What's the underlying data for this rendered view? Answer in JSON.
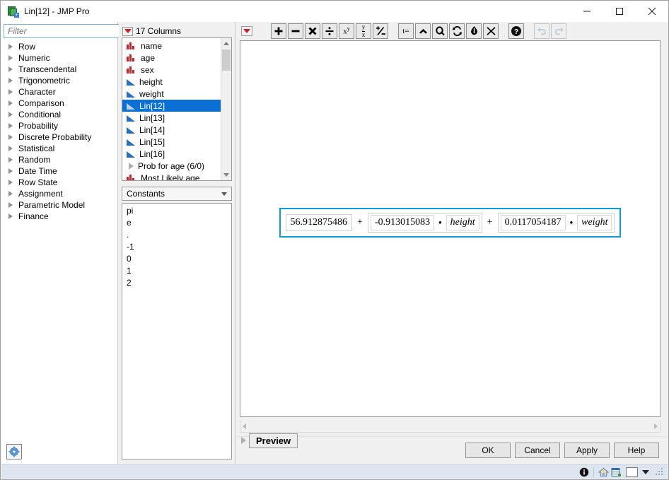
{
  "window": {
    "title": "Lin[12] - JMP Pro",
    "app_icon": "jmp-formula-icon",
    "minimize": "minimize-icon",
    "maximize": "maximize-icon",
    "close": "close-icon"
  },
  "left_panel": {
    "filter": {
      "placeholder": "Filter",
      "value": "",
      "search_icon": "search-icon",
      "dropdown_icon": "chevron-down-icon"
    },
    "functions": [
      {
        "label": "Row"
      },
      {
        "label": "Numeric"
      },
      {
        "label": "Transcendental"
      },
      {
        "label": "Trigonometric"
      },
      {
        "label": "Character"
      },
      {
        "label": "Comparison"
      },
      {
        "label": "Conditional"
      },
      {
        "label": "Probability"
      },
      {
        "label": "Discrete Probability"
      },
      {
        "label": "Statistical"
      },
      {
        "label": "Random"
      },
      {
        "label": "Date Time"
      },
      {
        "label": "Row State"
      },
      {
        "label": "Assignment"
      },
      {
        "label": "Parametric Model"
      },
      {
        "label": "Finance"
      }
    ],
    "settings_button": "settings-gear"
  },
  "columns_panel": {
    "header": "17 Columns",
    "header_menu_icon": "red-triangle-menu",
    "items": [
      {
        "label": "name",
        "type": "nominal",
        "selected": false
      },
      {
        "label": "age",
        "type": "nominal",
        "selected": false
      },
      {
        "label": "sex",
        "type": "nominal",
        "selected": false
      },
      {
        "label": "height",
        "type": "continuous",
        "selected": false
      },
      {
        "label": "weight",
        "type": "continuous",
        "selected": false
      },
      {
        "label": "Lin[12]",
        "type": "continuous-dim",
        "selected": true
      },
      {
        "label": "Lin[13]",
        "type": "continuous",
        "selected": false
      },
      {
        "label": "Lin[14]",
        "type": "continuous",
        "selected": false
      },
      {
        "label": "Lin[15]",
        "type": "continuous",
        "selected": false
      },
      {
        "label": "Lin[16]",
        "type": "continuous",
        "selected": false
      },
      {
        "label": "Prob for age (6/0)",
        "type": "group",
        "selected": false
      },
      {
        "label": "Most Likely age",
        "type": "nominal",
        "selected": false
      }
    ],
    "category_select": {
      "value": "Constants",
      "caret_icon": "chevron-down-icon"
    },
    "constants": [
      "pi",
      "e",
      ".",
      "-1",
      "0",
      "1",
      "2"
    ]
  },
  "editor": {
    "menu_icon": "red-triangle-menu",
    "toolbar_group_1": [
      {
        "name": "add-button",
        "glyph": "+"
      },
      {
        "name": "subtract-button",
        "glyph": "−"
      },
      {
        "name": "multiply-button",
        "glyph": "✕"
      },
      {
        "name": "divide-button",
        "glyph": "÷"
      },
      {
        "name": "power-button",
        "glyph": "xʸ"
      },
      {
        "name": "root-button",
        "glyph": "y/x"
      },
      {
        "name": "sign-toggle-button",
        "glyph": "±"
      }
    ],
    "toolbar_group_2": [
      {
        "name": "local-variable-button",
        "glyph": "t="
      },
      {
        "name": "insert-above-button",
        "glyph": "⌃"
      },
      {
        "name": "peel-button",
        "glyph": "↺"
      },
      {
        "name": "swap-button",
        "glyph": "⇆"
      },
      {
        "name": "unpeel-button",
        "glyph": "⇅"
      },
      {
        "name": "delete-button",
        "glyph": "✕"
      }
    ],
    "help_button": {
      "name": "help-button",
      "glyph": "?"
    },
    "undo_button": {
      "name": "undo-button",
      "glyph": "↶",
      "disabled": true
    },
    "redo_button": {
      "name": "redo-button",
      "glyph": "↷",
      "disabled": true
    },
    "formula": {
      "intercept": "56.912875486",
      "op1": "+",
      "coef1": "-0.913015083",
      "mul1": "•",
      "var1": "height",
      "op2": "+",
      "coef2": "0.0117054187",
      "mul2": "•",
      "var2": "weight"
    },
    "preview_label": "Preview",
    "buttons": [
      {
        "label": "OK",
        "name": "ok-button"
      },
      {
        "label": "Cancel",
        "name": "cancel-button"
      },
      {
        "label": "Apply",
        "name": "apply-button"
      },
      {
        "label": "Help",
        "name": "help-dialog-button"
      }
    ]
  },
  "status_bar": {
    "info_icon": "info-icon",
    "home_icon": "home-icon",
    "table_icon": "data-table-icon",
    "color_swatch": "#ffffff",
    "swatch_caret": "chevron-down-icon",
    "resize_grip": "resize-grip"
  }
}
